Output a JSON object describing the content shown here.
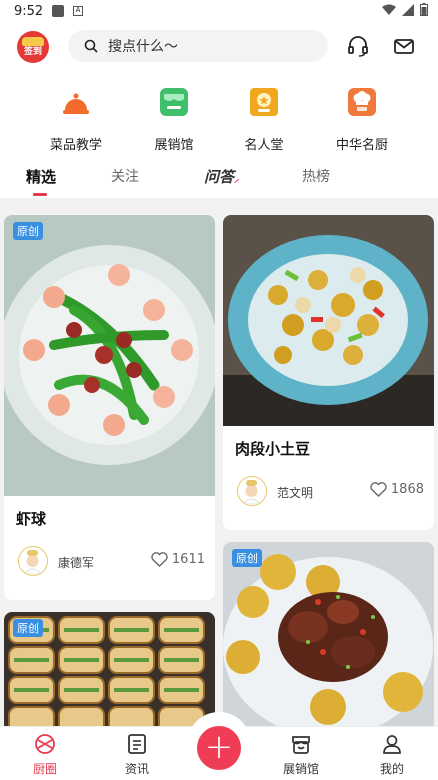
{
  "status": {
    "time": "9:52"
  },
  "header": {
    "logo_text": "签到",
    "search_placeholder": "搜点什么～",
    "icons": [
      "headset-icon",
      "mail-icon"
    ]
  },
  "categories": [
    {
      "label": "菜品教学",
      "icon": "cloche-icon",
      "color": "#f26b2b"
    },
    {
      "label": "展销馆",
      "icon": "store-icon",
      "color": "#3fbf6b"
    },
    {
      "label": "名人堂",
      "icon": "medal-icon",
      "color": "#f0a81e"
    },
    {
      "label": "中华名厨",
      "icon": "chef-icon",
      "color": "#f07a3c"
    }
  ],
  "tabs": [
    {
      "label": "精选",
      "active": true
    },
    {
      "label": "关注"
    },
    {
      "label": "问答"
    },
    {
      "label": "热榜"
    }
  ],
  "feed": [
    {
      "badge": "原创",
      "title": "虾球",
      "author": "康德军",
      "likes": "1611"
    },
    {
      "badge": "",
      "title": "肉段小土豆",
      "author": "范文明",
      "likes": "1868"
    },
    {
      "badge": "原创",
      "title": "",
      "author": "",
      "likes": ""
    },
    {
      "badge": "原创",
      "title": "",
      "author": "",
      "likes": ""
    }
  ],
  "tabbar": [
    {
      "label": "厨圈",
      "active": true
    },
    {
      "label": "资讯"
    },
    {
      "label": "展销馆"
    },
    {
      "label": "我的"
    }
  ],
  "colors": {
    "accent": "#e53a4f",
    "badge": "#3a8fe0"
  }
}
